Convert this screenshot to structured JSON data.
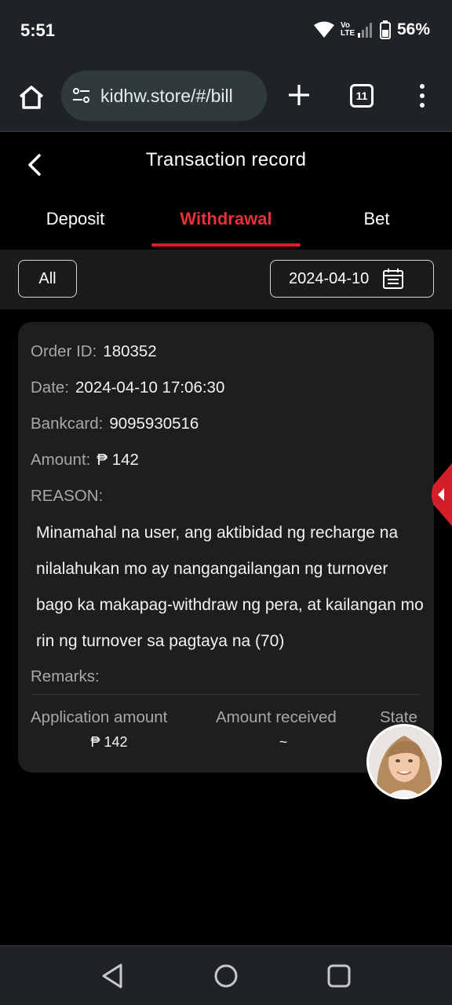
{
  "status": {
    "time": "5:51",
    "battery": "56%",
    "network": "Vo LTE"
  },
  "browser": {
    "url": "kidhw.store/#/bill",
    "tab_count": "11"
  },
  "header": {
    "title": "Transaction record"
  },
  "tabs": [
    {
      "label": "Deposit",
      "active": false
    },
    {
      "label": "Withdrawal",
      "active": true
    },
    {
      "label": "Bet",
      "active": false
    }
  ],
  "filter": {
    "type_label": "All",
    "date": "2024-04-10"
  },
  "record": {
    "order_id_label": "Order ID:",
    "order_id": "180352",
    "date_label": "Date:",
    "date": "2024-04-10 17:06:30",
    "bankcard_label": "Bankcard:",
    "bankcard": "9095930516",
    "amount_label": "Amount:",
    "amount": "₱ 142",
    "reason_label": "REASON:",
    "reason": "Minamahal na user, ang aktibidad ng recharge na nilalahukan mo ay nangangailangan ng turnover bago ka makapag-withdraw ng pera, at kailangan mo rin ng turnover sa pagtaya na (70)",
    "remarks_label": "Remarks:",
    "columns": [
      {
        "header": "Application amount",
        "value": "₱ 142"
      },
      {
        "header": "Amount received",
        "value": "~"
      },
      {
        "header": "State",
        "value": ""
      }
    ]
  },
  "colors": {
    "accent": "#e01d27",
    "card": "#1e1e1f",
    "background": "#000000"
  }
}
